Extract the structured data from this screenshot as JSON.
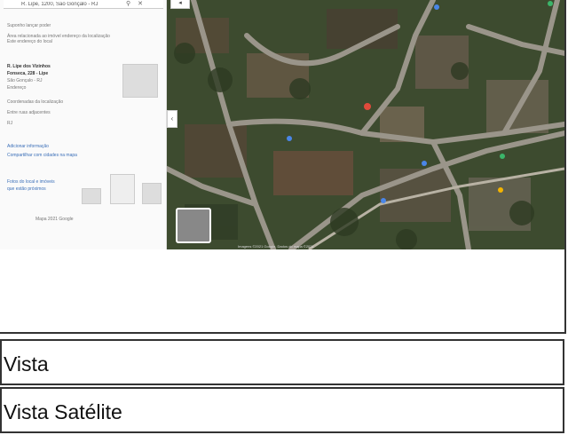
{
  "panel": {
    "search_text": "R. Lipe, 1200, São Gonçalo - RJ",
    "lines": [
      "Suponho lançar poder",
      "Área relacionada ao imóvel endereço da localização",
      "Este endereço do local",
      "R. Lipe dos Vizinhos",
      "Fonseca, 228 - Lipe",
      "São Gonçalo - RJ",
      "Endereço",
      "Coordenadas da localização",
      "Entre ruas adjacentes",
      "RJ",
      "Adicionar informação",
      "Compartilhar com cidades na mapa",
      "Fotos do local e imóveis",
      "que estão próximos",
      "Mapa 2021 Google"
    ]
  },
  "map": {
    "credit": "Imagens ©2021 Google, Dados do mapa ©2021"
  },
  "options": [
    {
      "label": "Vista"
    },
    {
      "label": "Vista Satélite"
    }
  ],
  "colors": {
    "border": "#333333",
    "pin_red": "#e04a3b",
    "pin_blue": "#4a86e8"
  }
}
